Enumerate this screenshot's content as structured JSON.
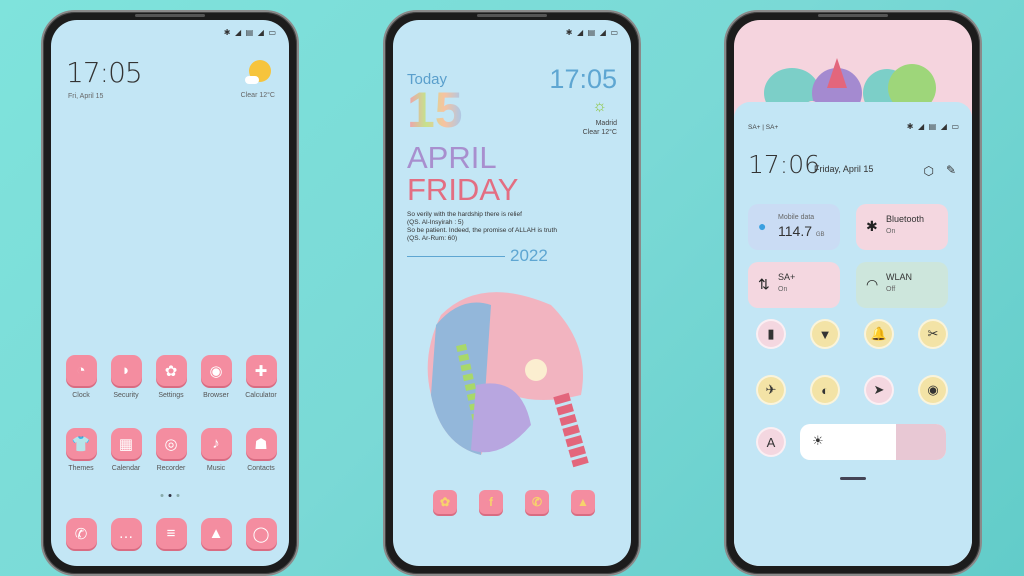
{
  "status_icons": "✱ ◢ ▤ ◢ ▭",
  "home": {
    "time": "17:05",
    "date": "Fri, April 15",
    "weather": "Clear  12°C",
    "apps_row1": [
      {
        "label": "Clock",
        "icon": "◔"
      },
      {
        "label": "Security",
        "icon": "◗"
      },
      {
        "label": "Settings",
        "icon": "✿"
      },
      {
        "label": "Browser",
        "icon": "◉"
      },
      {
        "label": "Calculator",
        "icon": "✚"
      }
    ],
    "apps_row2": [
      {
        "label": "Themes",
        "icon": "👕"
      },
      {
        "label": "Calendar",
        "icon": "▦"
      },
      {
        "label": "Recorder",
        "icon": "◎"
      },
      {
        "label": "Music",
        "icon": "♪"
      },
      {
        "label": "Contacts",
        "icon": "☗"
      }
    ],
    "dock": [
      {
        "name": "phone",
        "icon": "✆"
      },
      {
        "name": "messages",
        "icon": "…"
      },
      {
        "name": "notes",
        "icon": "≡"
      },
      {
        "name": "gallery",
        "icon": "▲"
      },
      {
        "name": "camera",
        "icon": "◯"
      }
    ],
    "page_indicator": {
      "pages": 3,
      "current": 2
    }
  },
  "widget": {
    "today": "Today",
    "time": "17:05",
    "day": "15",
    "city": "Madrid",
    "weather": "Clear 12°C",
    "month": "APRIL",
    "weekday": "FRIDAY",
    "quote_lines": [
      "So verily with the hardship there is relief",
      "(QS. Al-Insyirah : 5)",
      "So be patient. Indeed, the promise of ALLAH is truth",
      "(QS. Ar-Rum: 60)"
    ],
    "year": "2022",
    "dock": [
      {
        "name": "flower",
        "icon": "✿"
      },
      {
        "name": "facebook",
        "icon": "f"
      },
      {
        "name": "whatsapp",
        "icon": "✆"
      },
      {
        "name": "gallery",
        "icon": "▲"
      }
    ]
  },
  "control": {
    "carrier": "SA+ | SA+",
    "time": "17:06",
    "date": "Friday, April 15",
    "tiles": [
      {
        "title": "Mobile data",
        "value": "114.7",
        "unit": "GB",
        "icon": "💧"
      },
      {
        "title": "Bluetooth",
        "sub": "On",
        "icon": "✱"
      },
      {
        "title": "SA+",
        "sub": "On",
        "icon": "⇅"
      },
      {
        "title": "WLAN",
        "sub": "Off",
        "icon": "◠"
      }
    ],
    "toggles": [
      {
        "name": "vibrate",
        "icon": "▮",
        "active": true
      },
      {
        "name": "flashlight",
        "icon": "▼",
        "active": false
      },
      {
        "name": "bell",
        "icon": "🔔",
        "active": false
      },
      {
        "name": "screenshot",
        "icon": "✂",
        "active": false
      },
      {
        "name": "airplane",
        "icon": "✈",
        "active": false
      },
      {
        "name": "dark-mode",
        "icon": "◐",
        "active": false
      },
      {
        "name": "location",
        "icon": "➤",
        "active": true
      },
      {
        "name": "eye",
        "icon": "◉",
        "active": false
      }
    ],
    "auto_brightness": "A",
    "brightness_percent": 66
  }
}
